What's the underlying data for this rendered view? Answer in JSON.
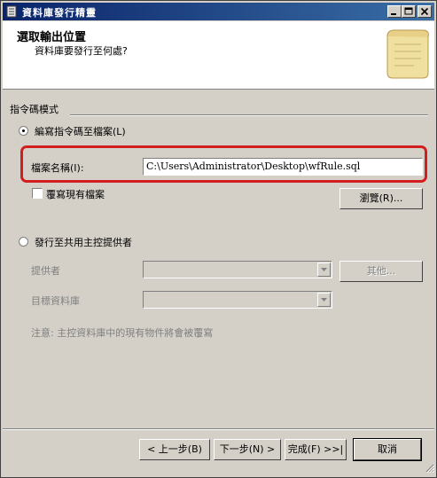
{
  "window": {
    "title": "資料庫發行精靈",
    "icon": "database-wizard-icon",
    "controls": [
      "minimize-icon",
      "maximize-icon",
      "close-icon"
    ]
  },
  "header": {
    "title": "選取輸出位置",
    "subtitle": "資料庫要發行至何處?",
    "art_icon": "scroll-icon"
  },
  "script_mode": {
    "group_label": "指令碼模式",
    "write_to_file": {
      "label": "編寫指令碼至檔案(L)",
      "selected": true,
      "file_name_label": "檔案名稱(I):",
      "file_name_value": "C:\\Users\\Administrator\\Desktop\\wfRule.sql",
      "overwrite_label": "覆寫現有檔案",
      "overwrite_checked": false,
      "browse_label": "瀏覽(R)..."
    },
    "publish_to_provider": {
      "label": "發行至共用主控提供者",
      "selected": false,
      "provider_label": "提供者",
      "provider_value": "",
      "other_label": "其他...",
      "target_db_label": "目標資料庫",
      "target_db_value": "",
      "note": "注意: 主控資料庫中的現有物件將會被覆寫"
    }
  },
  "footer": {
    "back_label": "< 上一步(B)",
    "next_label": "下一步(N) >",
    "finish_label": "完成(F) >>|",
    "cancel_label": "取消"
  },
  "colors": {
    "titlebar_start": "#0a246a",
    "titlebar_end": "#3a6ea5",
    "face": "#d4d0c8",
    "highlight": "#d21e1e"
  }
}
